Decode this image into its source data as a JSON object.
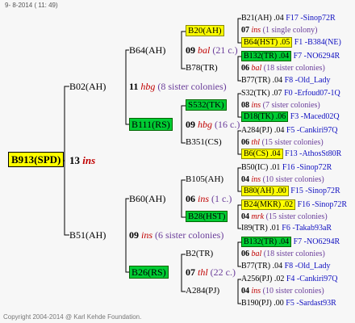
{
  "header": "9-  8-2014 ( 11: 49)",
  "footer": "Copyright 2004-2014 @ Karl Kehde Foundation.",
  "root": {
    "label": "B913(SPD)",
    "num": "13",
    "ins": "ins"
  },
  "gen1": [
    {
      "label": "B02(AH)",
      "num": "11",
      "ins": "hbg",
      "sis": "(8 sister colonies)"
    },
    {
      "label": "B51(AH)",
      "num": "09",
      "ins": "ins",
      "sis": "(6 sister colonies)"
    }
  ],
  "gen2": [
    {
      "label": "B64(AH)",
      "num": "09",
      "ins": "bal",
      "sis": "(21 c.)"
    },
    {
      "label": "B111(RS)",
      "num": "09",
      "ins": "hbg",
      "sis": "(16 c.)"
    },
    {
      "label": "B60(AH)",
      "num": "06",
      "ins": "ins",
      "sis": "(1 c.)"
    },
    {
      "label": "B26(RS)",
      "num": "07",
      "ins": "thl",
      "sis": "(22 c.)"
    }
  ],
  "gen3": [
    "B20(AH)",
    "B78(TR)",
    "S532(TK)",
    "B351(CS)",
    "B105(AH)",
    "B28(HST)",
    "B2(TR)",
    "A284(PJ)"
  ],
  "gen4": [
    {
      "a": "B21(AH) .04",
      "b": "F17 -Sinop72R"
    },
    {
      "num": "07",
      "ins": "ins",
      "sis": "(1 single colony)"
    },
    {
      "a": "B64(HST) .05",
      "b": "F1 -B384(NE)"
    },
    {
      "a": "B132(TR) .04",
      "b": "F7 -NO6294R"
    },
    {
      "num": "06",
      "ins": "bal",
      "sis": "(18 sister colonies)"
    },
    {
      "a": "B77(TR) .04",
      "b": "F8 -Old_Lady"
    },
    {
      "a": "S32(TK) .07",
      "b": "F0 -Erfoud07-1Q"
    },
    {
      "num": "08",
      "ins": "ins",
      "sis": "(7 sister colonies)"
    },
    {
      "a": "D18(TK) .06",
      "b": "F3 -Maced02Q"
    },
    {
      "a": "A284(PJ) .04",
      "b": "F5 -Cankiri97Q"
    },
    {
      "num": "06",
      "ins": "thl",
      "sis": "(15 sister colonies)"
    },
    {
      "a": "B6(CS) .04",
      "b": "F13 -AthosSt80R"
    },
    {
      "a": "B50(IC) .01",
      "b": "F16 -Sinop72R"
    },
    {
      "num": "04",
      "ins": "ins",
      "sis": "(10 sister colonies)"
    },
    {
      "a": "B80(AH) .00",
      "b": "F15 -Sinop72R"
    },
    {
      "a": "B24(MKR) .02",
      "b": "F16 -Sinop72R"
    },
    {
      "num": "04",
      "ins": "mrk",
      "sis": "(15 sister colonies)"
    },
    {
      "a": "I89(TR) .01",
      "b": "F6 -Takab93aR"
    },
    {
      "a": "B132(TR) .04",
      "b": "F7 -NO6294R"
    },
    {
      "num": "06",
      "ins": "bal",
      "sis": "(18 sister colonies)"
    },
    {
      "a": "B77(TR) .04",
      "b": "F8 -Old_Lady"
    },
    {
      "a": "A256(PJ) .02",
      "b": "F4 -Cankiri97Q"
    },
    {
      "num": "04",
      "ins": "ins",
      "sis": "(10 sister colonies)"
    },
    {
      "a": "B190(PJ) .00",
      "b": "F5 -Sardast93R"
    }
  ]
}
